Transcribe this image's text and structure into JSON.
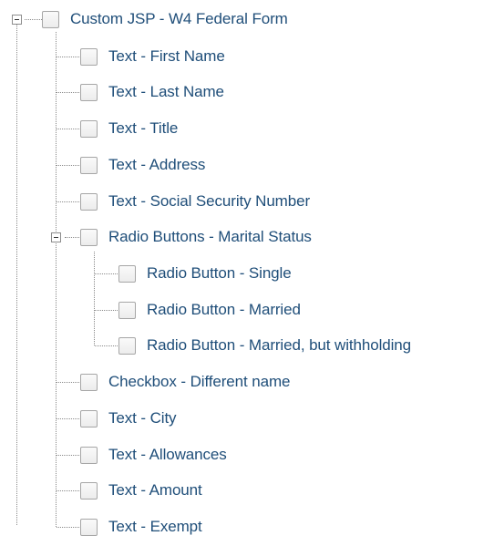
{
  "tree": {
    "root": {
      "label": "Custom JSP - W4 Federal Form",
      "expanded": true,
      "checked": false
    },
    "children": [
      {
        "label": "Text - First Name",
        "checked": false
      },
      {
        "label": "Text - Last Name",
        "checked": false
      },
      {
        "label": "Text - Title",
        "checked": false
      },
      {
        "label": "Text - Address",
        "checked": false
      },
      {
        "label": "Text - Social Security Number",
        "checked": false
      },
      {
        "label": "Radio Buttons - Marital Status",
        "expanded": true,
        "checked": false,
        "children": [
          {
            "label": "Radio Button - Single",
            "checked": false
          },
          {
            "label": "Radio Button - Married",
            "checked": false
          },
          {
            "label": "Radio Button - Married, but withholding",
            "checked": false
          }
        ]
      },
      {
        "label": "Checkbox - Different name",
        "checked": false
      },
      {
        "label": "Text - City",
        "checked": false
      },
      {
        "label": "Text - Allowances",
        "checked": false
      },
      {
        "label": "Text - Amount",
        "checked": false
      },
      {
        "label": "Text - Exempt",
        "checked": false
      }
    ]
  },
  "icons": {
    "toggle": "collapse-minus-icon",
    "checkbox": "unchecked-box"
  },
  "colors": {
    "label_text": "#1f4e79",
    "connector": "#8a8a8a",
    "checkbox_border": "#a6a6a6"
  }
}
